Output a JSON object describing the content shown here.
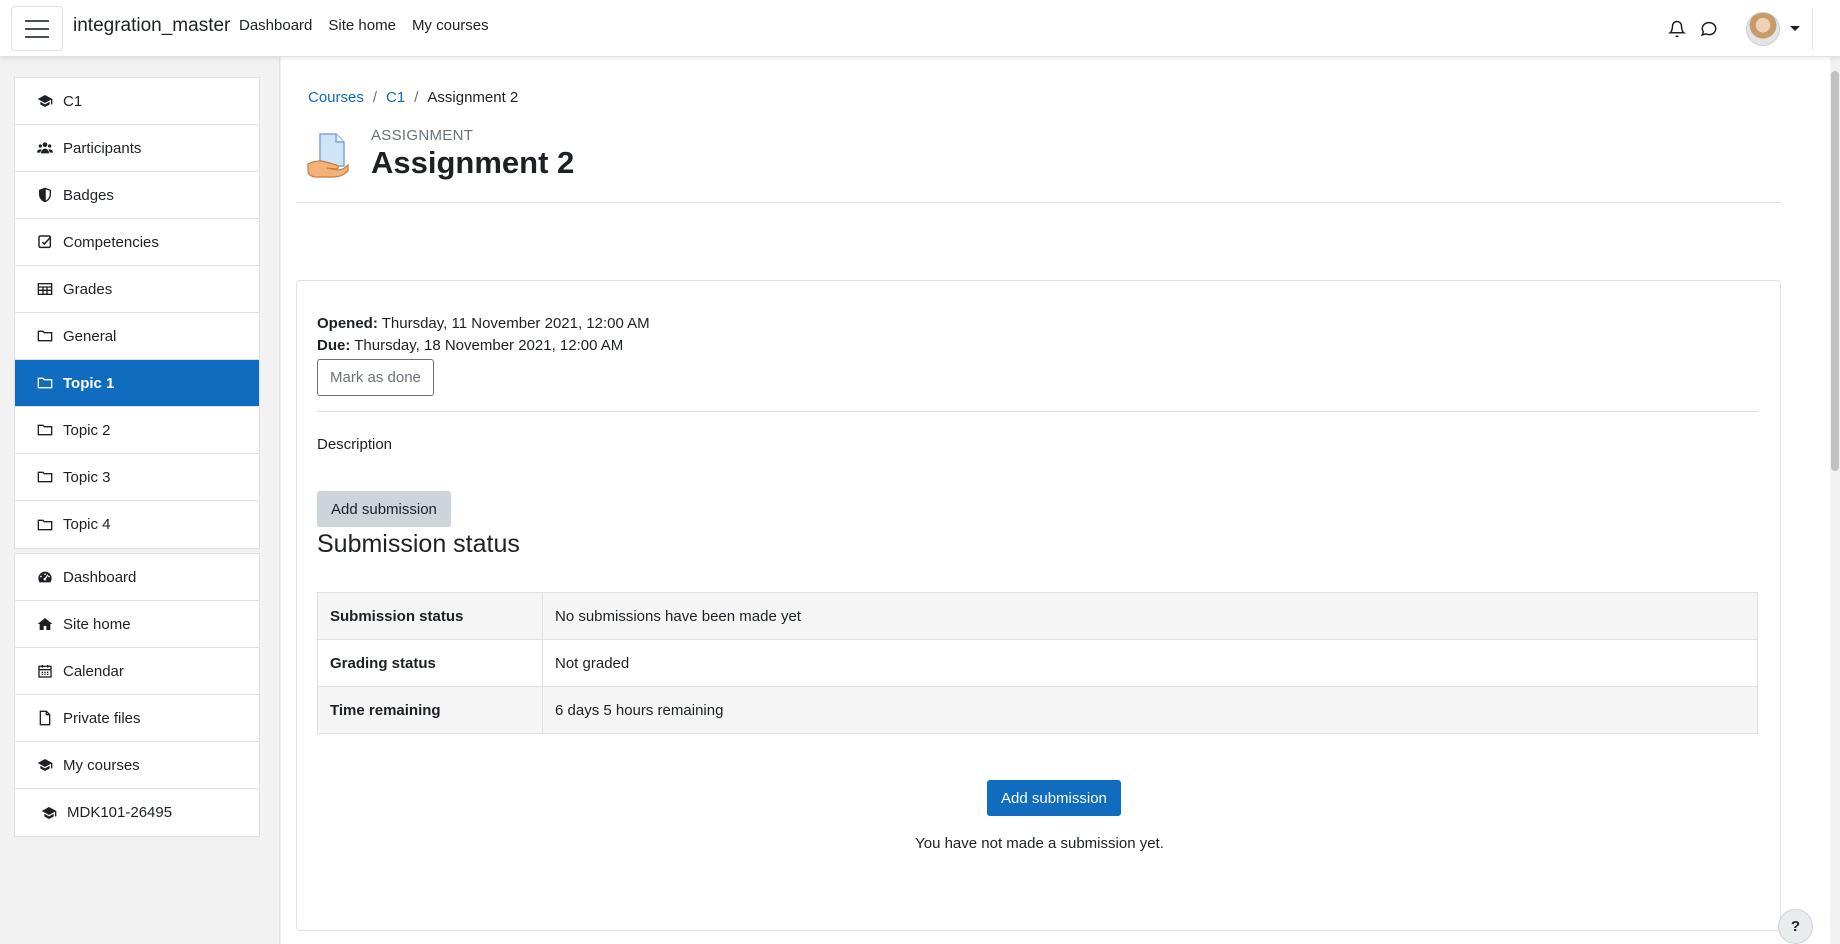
{
  "navbar": {
    "brand": "integration_master",
    "links": [
      "Dashboard",
      "Site home",
      "My courses"
    ],
    "icons": [
      "bell-icon",
      "chat-icon"
    ]
  },
  "drawer": {
    "course_items": [
      {
        "label": "C1",
        "icon": "graduation-cap-icon"
      },
      {
        "label": "Participants",
        "icon": "users-icon"
      },
      {
        "label": "Badges",
        "icon": "shield-icon"
      },
      {
        "label": "Competencies",
        "icon": "check-square-icon"
      },
      {
        "label": "Grades",
        "icon": "table-icon"
      },
      {
        "label": "General",
        "icon": "folder-icon"
      },
      {
        "label": "Topic 1",
        "icon": "folder-icon",
        "active": true
      },
      {
        "label": "Topic 2",
        "icon": "folder-icon"
      },
      {
        "label": "Topic 3",
        "icon": "folder-icon"
      },
      {
        "label": "Topic 4",
        "icon": "folder-icon"
      }
    ],
    "site_items": [
      {
        "label": "Dashboard",
        "icon": "tachometer-icon"
      },
      {
        "label": "Site home",
        "icon": "home-icon"
      },
      {
        "label": "Calendar",
        "icon": "calendar-icon"
      },
      {
        "label": "Private files",
        "icon": "file-icon"
      },
      {
        "label": "My courses",
        "icon": "graduation-cap-icon"
      },
      {
        "label": "MDK101-26495",
        "icon": "graduation-cap-icon"
      }
    ]
  },
  "breadcrumb": [
    "Courses",
    "C1",
    "Assignment 2"
  ],
  "header": {
    "module_label": "ASSIGNMENT",
    "title": "Assignment 2"
  },
  "assignment": {
    "opened_label": "Opened:",
    "opened_value": "Thursday, 11 November 2021, 12:00 AM",
    "due_label": "Due:",
    "due_value": "Thursday, 18 November 2021, 12:00 AM",
    "mark_done": "Mark as done",
    "description": "Description",
    "add_submission_top": "Add submission",
    "section_title": "Submission status",
    "status_rows": [
      {
        "label": "Submission status",
        "value": "No submissions have been made yet"
      },
      {
        "label": "Grading status",
        "value": "Not graded"
      },
      {
        "label": "Time remaining",
        "value": "6 days 5 hours remaining"
      }
    ],
    "add_submission": "Add submission",
    "no_submission_note": "You have not made a submission yet."
  },
  "help": "?",
  "colors": {
    "primary": "#0f6cbf",
    "border": "#dee2e6",
    "text": "#1d2125",
    "muted": "#6a737b"
  }
}
